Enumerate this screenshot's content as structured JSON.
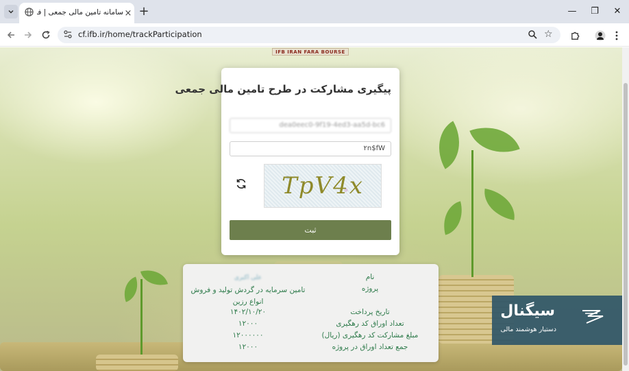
{
  "browser": {
    "tab_title": "سامانه تامین مالی جمعی | فرابورس",
    "tab_close": "×",
    "new_tab": "+",
    "url": "cf.ifb.ir/home/trackParticipation",
    "window_controls": {
      "minimize": "—",
      "restore": "❐",
      "close": "✕"
    }
  },
  "page": {
    "brand_strip": "IFB IRAN FARA BOURSE",
    "form": {
      "title": "پیگیری مشارکت در طرح تامین مالی جمعی",
      "tracking_code_value": "dea0eec0-9f19-4ed3-aa5d-bc6",
      "captcha_input_value": "۲n$fW",
      "captcha_image_text": "TpV4x",
      "submit_label": "ثبت"
    },
    "result": {
      "labels": [
        "نام",
        "پروژه",
        "تاریخ پرداخت",
        "تعداد اوراق کد رهگیری",
        "مبلغ مشارکت کد رهگیری (ریال)",
        "جمع تعداد اوراق در پروژه"
      ],
      "name_value": "علی اکبری",
      "project_value": "تامین سرمایه در گردش تولید و فروش انواع رزین",
      "payment_date": "۱۴۰۲/۱۰/۲۰",
      "papers_count": "۱۲۰۰۰",
      "amount": "۱۲۰۰۰۰۰۰",
      "total_papers": "۱۲۰۰۰"
    },
    "promo": {
      "title": "سیگنال",
      "subtitle": "دستیار هوشمند مالی"
    }
  },
  "colors": {
    "submit": "#6d7f4d",
    "result_text": "#2d7a4a",
    "promo_bg": "#305668"
  }
}
